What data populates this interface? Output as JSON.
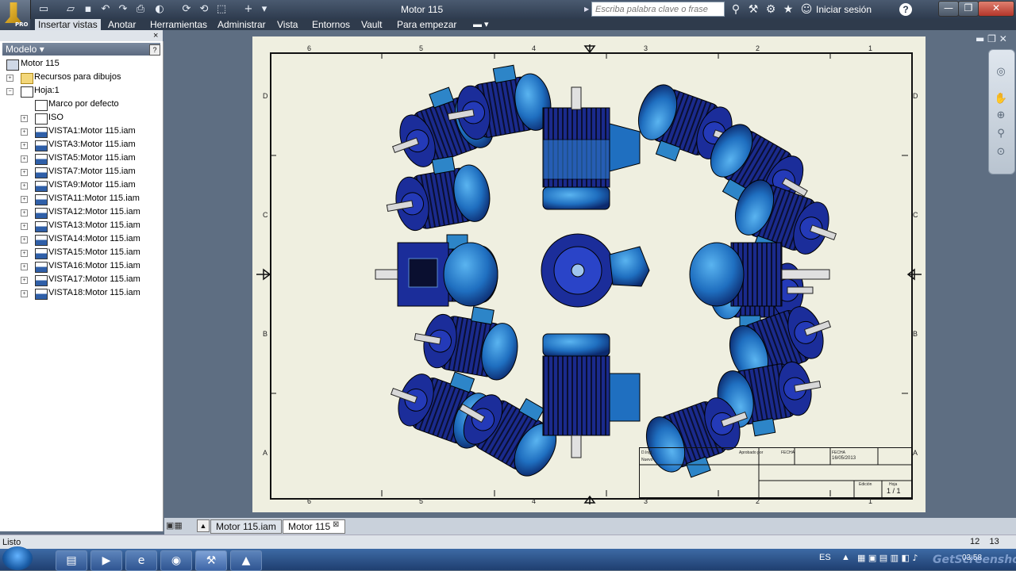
{
  "app": {
    "title": "Motor 115",
    "badge": "PRO",
    "search_placeholder": "Escriba palabra clave o frase",
    "signin": "Iniciar sesión",
    "help": "?",
    "minimize": "—",
    "restore": "❐",
    "close": "✕"
  },
  "ribbon": {
    "tabs": [
      "Insertar vistas",
      "Anotar",
      "Herramientas",
      "Administrar",
      "Vista",
      "Entornos",
      "Vault",
      "Para empezar"
    ]
  },
  "browser": {
    "close": "×",
    "header": "Modelo ▾",
    "help": "?",
    "items": [
      {
        "label": "Motor 115"
      },
      {
        "label": "Recursos para dibujos"
      },
      {
        "label": "Hoja:1"
      },
      {
        "label": "Marco por defecto"
      },
      {
        "label": "ISO"
      },
      {
        "label": "VISTA1:Motor 115.iam"
      },
      {
        "label": "VISTA3:Motor 115.iam"
      },
      {
        "label": "VISTA5:Motor 115.iam"
      },
      {
        "label": "VISTA7:Motor 115.iam"
      },
      {
        "label": "VISTA9:Motor 115.iam"
      },
      {
        "label": "VISTA11:Motor 115.iam"
      },
      {
        "label": "VISTA12:Motor 115.iam"
      },
      {
        "label": "VISTA13:Motor 115.iam"
      },
      {
        "label": "VISTA14:Motor 115.iam"
      },
      {
        "label": "VISTA15:Motor 115.iam"
      },
      {
        "label": "VISTA16:Motor 115.iam"
      },
      {
        "label": "VISTA17:Motor 115.iam"
      },
      {
        "label": "VISTA18:Motor 115.iam"
      }
    ]
  },
  "sheet": {
    "zones_top": [
      "6",
      "5",
      "4",
      "3",
      "2",
      "1"
    ],
    "zones_side": [
      "D",
      "C",
      "B",
      "A"
    ],
    "title_block": {
      "fecha_label": "FECHA",
      "fecha": "16/05/2013",
      "aprobado": "Aprobado por",
      "fecha2_label": "FECHA",
      "ingl": "D.Ingl.",
      "nuevo": "Nuevo",
      "hoja_label": "Hoja",
      "hoja": "1 / 1",
      "edicion": "Edición"
    }
  },
  "sheet_tabs": [
    "Motor 115.iam",
    "Motor 115"
  ],
  "status": {
    "text": "Listo",
    "n1": "12",
    "n2": "13"
  },
  "tray": {
    "lang": "ES",
    "time": "03:58"
  },
  "watermark": "GetScreenshot",
  "colors": {
    "motor_dark": "#1a2a8c",
    "motor_light": "#3b9be0",
    "sheet": "#efefe0",
    "background": "#5e6e82"
  }
}
